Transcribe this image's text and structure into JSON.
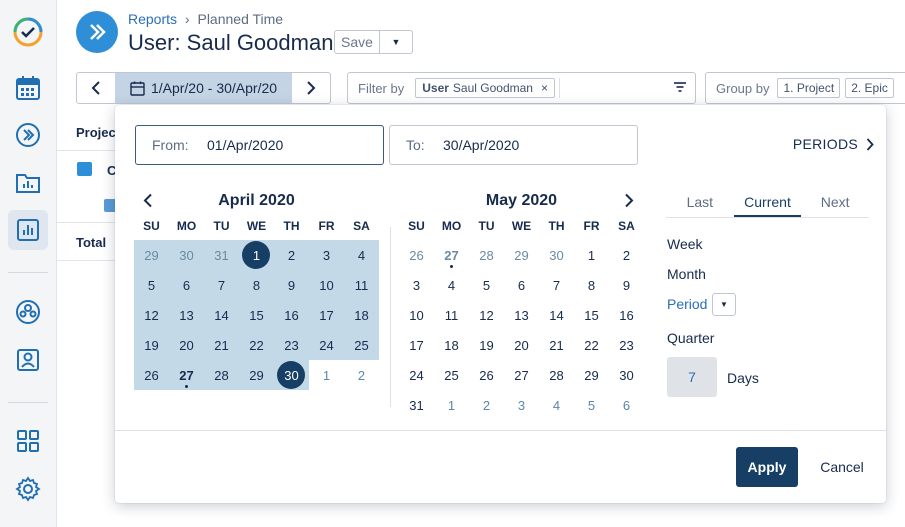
{
  "breadcrumb": {
    "parent": "Reports",
    "current": "Planned Time"
  },
  "title": "User: Saul Goodman",
  "save_label": "Save",
  "date_range": "1/Apr/20 - 30/Apr/20",
  "filter": {
    "label": "Filter by",
    "chip_key": "User",
    "chip_value": "Saul Goodman",
    "remove": "×"
  },
  "group": {
    "label": "Group by",
    "chips": [
      "1. Project",
      "2. Epic"
    ]
  },
  "table_peek": {
    "header": "Projec",
    "row": "C",
    "total": "Total"
  },
  "popup": {
    "from_label": "From:",
    "from_value": "01/Apr/2020",
    "to_label": "To:",
    "to_value": "30/Apr/2020",
    "periods_label": "PERIODS",
    "weekday_headers": [
      "SU",
      "MO",
      "TU",
      "WE",
      "TH",
      "FR",
      "SA"
    ],
    "april": {
      "title": "April 2020",
      "weeks": [
        [
          "29",
          "30",
          "31",
          "1",
          "2",
          "3",
          "4"
        ],
        [
          "5",
          "6",
          "7",
          "8",
          "9",
          "10",
          "11"
        ],
        [
          "12",
          "13",
          "14",
          "15",
          "16",
          "17",
          "18"
        ],
        [
          "19",
          "20",
          "21",
          "22",
          "23",
          "24",
          "25"
        ],
        [
          "26",
          "27",
          "28",
          "29",
          "30",
          "1",
          "2"
        ]
      ]
    },
    "may": {
      "title": "May 2020",
      "weeks": [
        [
          "26",
          "27",
          "28",
          "29",
          "30",
          "1",
          "2"
        ],
        [
          "3",
          "4",
          "5",
          "6",
          "7",
          "8",
          "9"
        ],
        [
          "10",
          "11",
          "12",
          "13",
          "14",
          "15",
          "16"
        ],
        [
          "17",
          "18",
          "19",
          "20",
          "21",
          "22",
          "23"
        ],
        [
          "24",
          "25",
          "26",
          "27",
          "28",
          "29",
          "30"
        ],
        [
          "31",
          "1",
          "2",
          "3",
          "4",
          "5",
          "6"
        ]
      ]
    },
    "period_tabs": [
      "Last",
      "Current",
      "Next"
    ],
    "active_tab": "Current",
    "period_options": [
      "Week",
      "Month",
      "Period",
      "Quarter"
    ],
    "days_value": "7",
    "days_label": "Days",
    "apply_label": "Apply",
    "cancel_label": "Cancel"
  }
}
